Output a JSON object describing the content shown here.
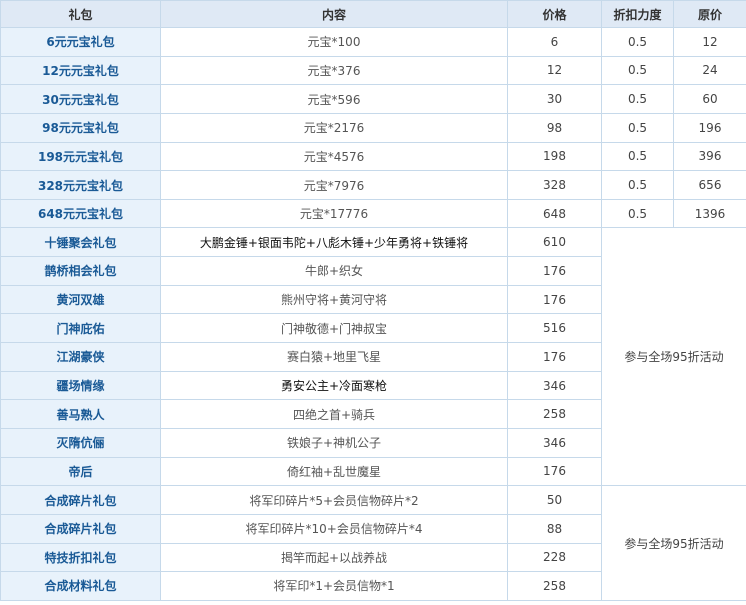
{
  "headers": {
    "pack": "礼包",
    "content": "内容",
    "price": "价格",
    "discount": "折扣力度",
    "original": "原价"
  },
  "rows": [
    {
      "name": "6元元宝礼包",
      "content": "元宝*100",
      "price": "6",
      "discount": "0.5",
      "original": "12"
    },
    {
      "name": "12元元宝礼包",
      "content": "元宝*376",
      "price": "12",
      "discount": "0.5",
      "original": "24"
    },
    {
      "name": "30元元宝礼包",
      "content": "元宝*596",
      "price": "30",
      "discount": "0.5",
      "original": "60"
    },
    {
      "name": "98元元宝礼包",
      "content": "元宝*2176",
      "price": "98",
      "discount": "0.5",
      "original": "196"
    },
    {
      "name": "198元元宝礼包",
      "content": "元宝*4576",
      "price": "198",
      "discount": "0.5",
      "original": "396"
    },
    {
      "name": "328元元宝礼包",
      "content": "元宝*7976",
      "price": "328",
      "discount": "0.5",
      "original": "656"
    },
    {
      "name": "648元元宝礼包",
      "content": "元宝*17776",
      "price": "648",
      "discount": "0.5",
      "original": "1396"
    },
    {
      "name": "十锤聚会礼包",
      "content": "大鹏金锤+银面韦陀+八彪木锤+少年勇将+铁锤将",
      "price": "610"
    },
    {
      "name": "鹊桥相会礼包",
      "content": "牛郎+织女",
      "price": "176"
    },
    {
      "name": "黄河双雄",
      "content": "熊州守将+黄河守将",
      "price": "176"
    },
    {
      "name": "门神庇佑",
      "content": "门神敬德+门神叔宝",
      "price": "516"
    },
    {
      "name": "江湖豪侠",
      "content": "赛白猿+地里飞星",
      "price": "176"
    },
    {
      "name": "疆场情缘",
      "content": "勇安公主+冷面寒枪",
      "price": "346"
    },
    {
      "name": "善马熟人",
      "content": "四绝之首+骑兵",
      "price": "258"
    },
    {
      "name": "灭隋伉俪",
      "content": "铁娘子+神机公子",
      "price": "346"
    },
    {
      "name": "帝后",
      "content": "倚红袖+乱世魔星",
      "price": "176"
    },
    {
      "name": "合成碎片礼包",
      "content": "将军印碎片*5+会员信物碎片*2",
      "price": "50"
    },
    {
      "name": "合成碎片礼包",
      "content": "将军印碎片*10+会员信物碎片*4",
      "price": "88"
    },
    {
      "name": "特技折扣礼包",
      "content": "揭竿而起+以战养战",
      "price": "228"
    },
    {
      "name": "合成材料礼包",
      "content": "将军印*1+会员信物*1",
      "price": "258"
    }
  ],
  "notes": {
    "group1": "参与全场95折活动",
    "group2": "参与全场95折活动"
  }
}
